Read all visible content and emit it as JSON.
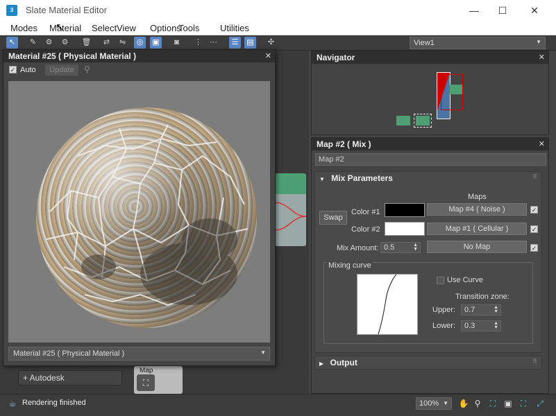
{
  "app": {
    "title": "Slate Material Editor",
    "icon_label": "3",
    "window_controls": [
      "—",
      "☐",
      "✕"
    ]
  },
  "menu": [
    "Modes",
    "Material",
    "Select",
    "View",
    "Options",
    "Tools",
    "Utilities"
  ],
  "toolbar": {
    "view_select": "View1"
  },
  "material_window": {
    "title": "Material #25  ( Physical Material )",
    "auto_label": "Auto",
    "auto_checked": true,
    "update_label": "Update",
    "selector_value": "Material #25  ( Physical Material )"
  },
  "navigator": {
    "title": "Navigator"
  },
  "map_window": {
    "title": "Map #2  ( Mix )",
    "map_name": "Map #2",
    "mix_params": {
      "title": "Mix Parameters",
      "maps_header": "Maps",
      "swap_label": "Swap",
      "color1_label": "Color #1",
      "color1": "#000000",
      "color1_map": "Map #4  ( Noise )",
      "color2_label": "Color #2",
      "color2": "#ffffff",
      "color2_map": "Map #1  ( Cellular )",
      "mix_amount_label": "Mix Amount:",
      "mix_amount": "0.5",
      "mix_map": "No Map",
      "mixing_curve_label": "Mixing curve",
      "use_curve_label": "Use Curve",
      "transition_zone_label": "Transition zone:",
      "upper_label": "Upper:",
      "upper": "0.7",
      "lower_label": "Lower:",
      "lower": "0.3"
    },
    "output_label": "Output"
  },
  "lower_panel": {
    "autodesk_label": "+ Autodesk",
    "node_label": "Map"
  },
  "status": {
    "text": "Rendering finished",
    "zoom": "100%"
  }
}
